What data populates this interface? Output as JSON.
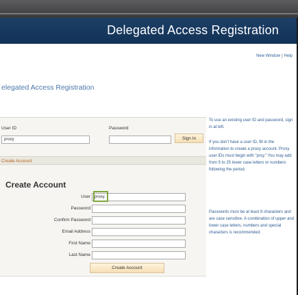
{
  "header": {
    "title": "Delegated Access Registration"
  },
  "util_links": {
    "new_window": "New Window",
    "separator": "|",
    "help": "Help"
  },
  "page": {
    "heading": "elegated Access Registration"
  },
  "signin": {
    "user_id_label": "User ID",
    "user_id_value": "proxy",
    "password_label": "Password",
    "password_value": "",
    "signin_button": "Sign In"
  },
  "create_account_bar": {
    "label": "Create Account"
  },
  "create_account_form": {
    "heading": "Create Account",
    "user_label": "User",
    "user_value": "proxy.",
    "password_label": "Password",
    "confirm_password_label": "Confirm Password",
    "email_label": "Email Address",
    "first_name_label": "First Name",
    "last_name_label": "Last Name",
    "create_button": "Create Account"
  },
  "help": {
    "para1": "To use an existing user ID and password, sign in at left.",
    "para2": "If you don't have a user ID, fill in the information to create a proxy account. Proxy user IDs must begin with \"prxy.\" You may add from 5 to 25 lower case letters or numbers following the period.",
    "para3": "Passwords must be at least 8 characters and are case sensitive. A combination of upper and lower case letters, numbers and special characters is recommended."
  },
  "colors": {
    "header_bg": "#173a61",
    "link": "#2e5d97",
    "section_label": "#b5671f",
    "highlight": "#7fa53b",
    "button_bg": "#f9e7c6"
  }
}
